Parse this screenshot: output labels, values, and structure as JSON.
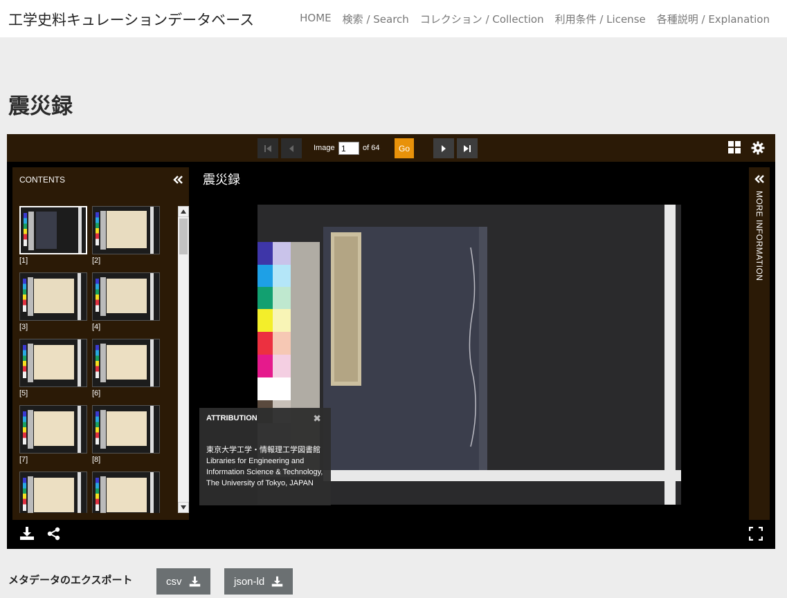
{
  "header": {
    "site_title": "工学史料キュレーションデータベース",
    "nav": [
      "HOME",
      "検索 / Search",
      "コレクション / Collection",
      "利用条件 / License",
      "各種説明 / Explanation"
    ]
  },
  "page_title": "震災録",
  "viewer": {
    "toolbar": {
      "image_label": "Image",
      "image_value": "1",
      "of_label": "of 64",
      "go_label": "Go"
    },
    "contents": {
      "heading": "CONTENTS",
      "thumbnails": [
        "[1]",
        "[2]",
        "[3]",
        "[4]",
        "[5]",
        "[6]",
        "[7]",
        "[8]",
        "",
        ""
      ]
    },
    "image_title": "震災録",
    "attribution": {
      "heading": "ATTRIBUTION",
      "text": "東京大学工学・情報理工学図書館 Libraries for Engineering and Information Science & Technology, The University of Tokyo, JAPAN"
    },
    "more_information": "MORE INFORMATION",
    "colors": {
      "toolbar": "#2b1a06",
      "go": "#e8920a"
    }
  },
  "export": {
    "label": "メタデータのエクスポート",
    "csv": "csv",
    "jsonld": "json-ld"
  }
}
